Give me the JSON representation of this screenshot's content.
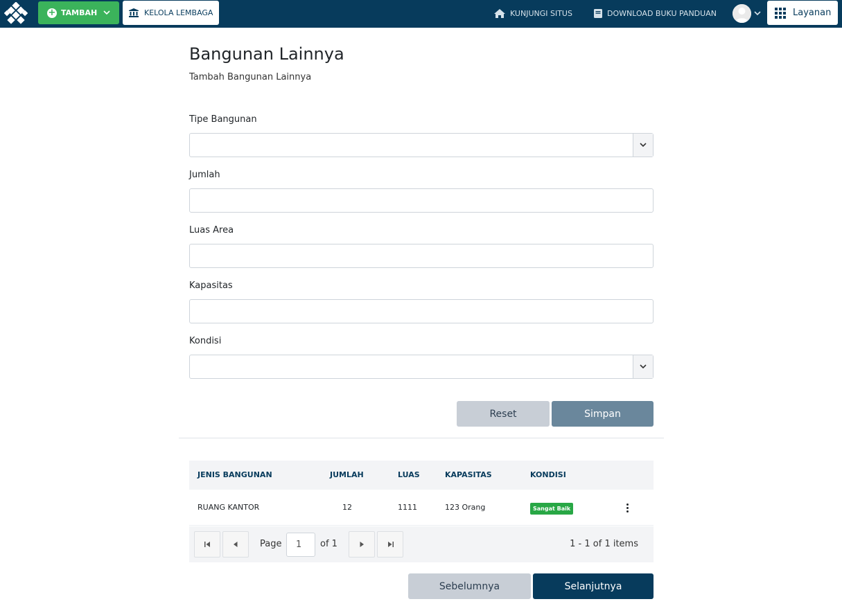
{
  "header": {
    "tambah_label": "TAMBAH",
    "kelola_label": "KELOLA LEMBAGA",
    "kunjungi_label": "KUNJUNGI SITUS",
    "download_label": "DOWNLOAD BUKU PANDUAN",
    "layanan_label": "Layanan"
  },
  "page": {
    "title": "Bangunan Lainnya",
    "subtitle": "Tambah Bangunan Lainnya"
  },
  "form": {
    "tipe_label": "Tipe Bangunan",
    "tipe_value": "",
    "jumlah_label": "Jumlah",
    "jumlah_value": "",
    "luas_label": "Luas Area",
    "luas_value": "",
    "kapasitas_label": "Kapasitas",
    "kapasitas_value": "",
    "kondisi_label": "Kondisi",
    "kondisi_value": "",
    "reset_label": "Reset",
    "simpan_label": "Simpan"
  },
  "table": {
    "headers": [
      "JENIS BANGUNAN",
      "JUMLAH",
      "LUAS",
      "KAPASITAS",
      "KONDISI"
    ],
    "rows": [
      {
        "jenis": "RUANG KANTOR",
        "jumlah": "12",
        "luas": "1111",
        "kapasitas": "123 Orang",
        "kondisi": "Sangat Baik"
      }
    ]
  },
  "pager": {
    "page_label": "Page",
    "page_value": "1",
    "of_label": "of 1",
    "info": "1 - 1 of 1 items"
  },
  "footer": {
    "prev_label": "Sebelumnya",
    "next_label": "Selanjutnya"
  },
  "colors": {
    "navbar": "#073b5c",
    "tambah": "#3bb35b",
    "badge_success": "#28a745",
    "primary_dark": "#073b5c",
    "muted_button": "#6a879c"
  },
  "icons": [
    "logo-icon",
    "plus-circle-icon",
    "chevron-down-icon",
    "bank-icon",
    "home-icon",
    "book-icon",
    "avatar",
    "grid-icon",
    "kebab-icon",
    "first-page-icon",
    "prev-page-icon",
    "next-page-icon",
    "last-page-icon"
  ]
}
